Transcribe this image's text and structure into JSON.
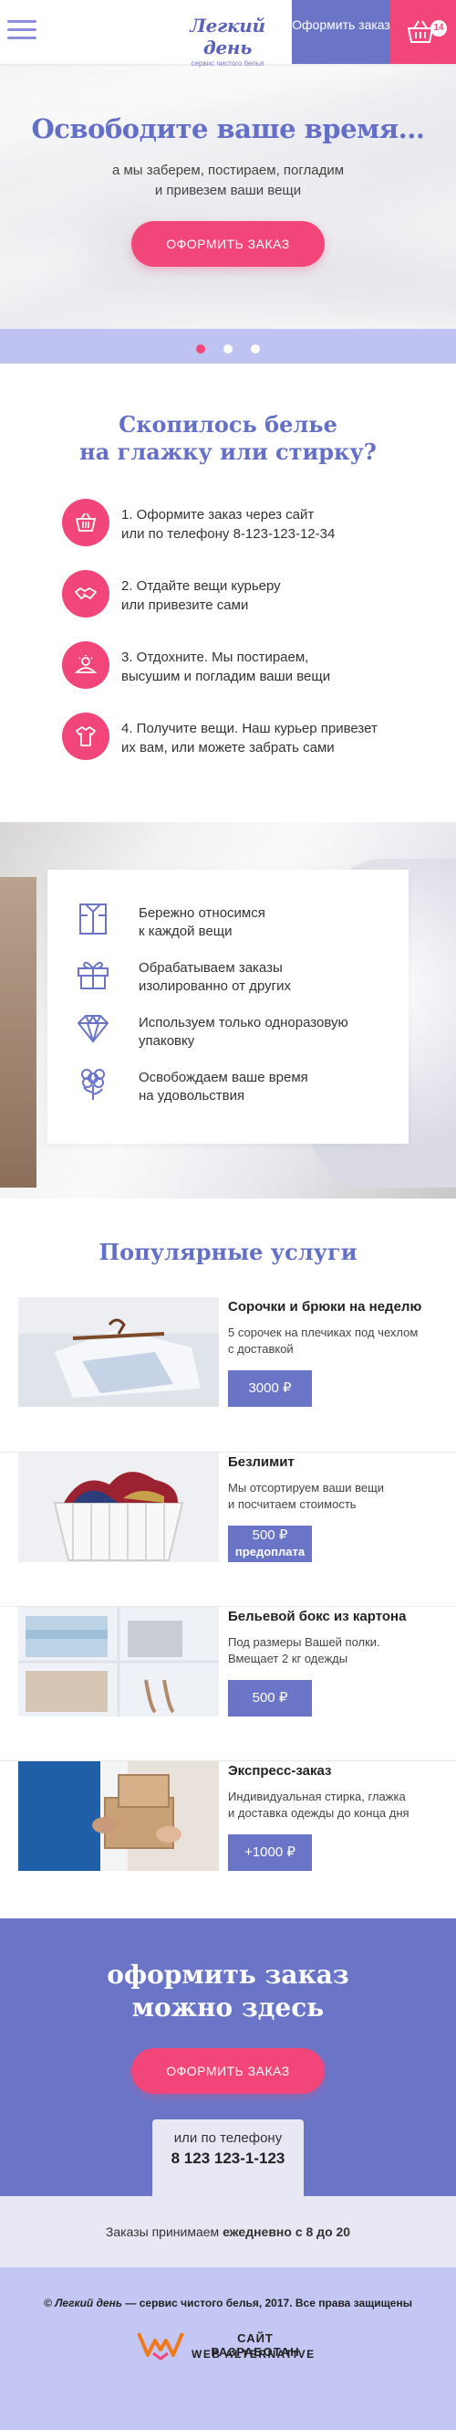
{
  "header": {
    "logo_title": "Легкий день",
    "logo_subtitle": "сервис чистого белья",
    "order_label": "Оформить заказ",
    "cart_count": "14"
  },
  "hero": {
    "title": "Освободите ваше время...",
    "subtitle_line1": "а мы заберем, постираем, погладим",
    "subtitle_line2": "и привезем ваши вещи",
    "button": "ОФОРМИТЬ ЗАКАЗ",
    "active_slide": 1,
    "slides": 3
  },
  "steps": {
    "title_line1": "Скопилось белье",
    "title_line2": "на глажку или стирку?",
    "items": [
      {
        "icon": "basket-icon",
        "line1": "1. Оформите заказ через сайт",
        "line2": "или по телефону 8-123-123-12-34"
      },
      {
        "icon": "handshake-icon",
        "line1": "2. Отдайте вещи курьеру",
        "line2": "или привезите сами"
      },
      {
        "icon": "relax-icon",
        "line1": "3. Отдохните. Мы постираем,",
        "line2": "высушим и погладим ваши вещи"
      },
      {
        "icon": "shirt-icon",
        "line1": "4. Получите вещи. Наш курьер привезет",
        "line2": "их вам, или можете забрать сами"
      }
    ]
  },
  "benefits": {
    "items": [
      {
        "icon": "folded-shirt-icon",
        "line1": "Бережно относимся",
        "line2": "к каждой вещи"
      },
      {
        "icon": "gift-icon",
        "line1": "Обрабатываем заказы",
        "line2": "изолированно от других"
      },
      {
        "icon": "diamond-icon",
        "line1": "Используем только одноразовую",
        "line2": "упаковку"
      },
      {
        "icon": "flower-icon",
        "line1": "Освобождаем ваше время",
        "line2": "на удовольствия"
      }
    ]
  },
  "services": {
    "title": "Популярные услуги",
    "items": [
      {
        "title": "Сорочки и брюки на неделю",
        "desc1": "5 сорочек на плечиках под чехлом",
        "desc2": "с доставкой",
        "price1": "3000 ₽",
        "price2": ""
      },
      {
        "title": "Безлимит",
        "desc1": "Мы отсортируем ваши вещи",
        "desc2": "и посчитаем стоимость",
        "price1": "500 ₽",
        "price2": "предоплата"
      },
      {
        "title": "Бельевой бокс из картона",
        "desc1": "Под размеры Вашей полки.",
        "desc2": "Вмещает 2 кг одежды",
        "price1": "500 ₽",
        "price2": ""
      },
      {
        "title": "Экспресс-заказ",
        "desc1": "Индивидуальная стирка, глажка",
        "desc2": "и доставка одежды до конца дня",
        "price1": "+1000 ₽",
        "price2": ""
      }
    ]
  },
  "cta": {
    "title_line1": "оформить заказ",
    "title_line2": "можно здесь",
    "button": "ОФОРМИТЬ ЗАКАЗ",
    "phone_label": "или по телефону",
    "phone": "8 123 123-1-123"
  },
  "hours": {
    "prefix": "Заказы принимаем ",
    "bold": "ежедневно с 8 до 20"
  },
  "footer": {
    "brand": "© Легкий день",
    "copyright": " — сервис чистого белья, 2017. Все права защищены",
    "dev_line1": "САЙТ РАЗРАБОТАН",
    "dev_line2": "WEB ALTERNATIVE"
  },
  "colors": {
    "accent_pink": "#f2467a",
    "accent_purple": "#6a75c8",
    "light_purple": "#c4c7f4"
  }
}
